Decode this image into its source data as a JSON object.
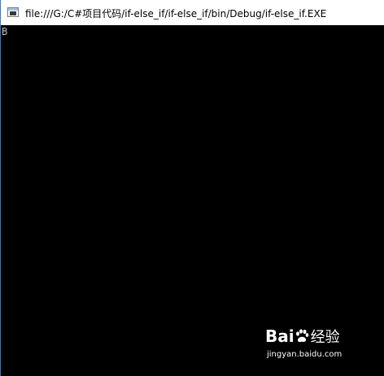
{
  "window": {
    "title": "file:///G:/C#项目代码/if-else_if/if-else_if/bin/Debug/if-else_if.EXE",
    "icon": "console-app-icon"
  },
  "console": {
    "output": "B"
  },
  "watermark": {
    "logo_part1": "Bai",
    "logo_part2": "百",
    "logo_cn": "经验",
    "url": "jingyan.baidu.com"
  },
  "colors": {
    "console_bg": "#000000",
    "console_text": "#c0c0c0",
    "window_border": "#2b7bd6"
  }
}
